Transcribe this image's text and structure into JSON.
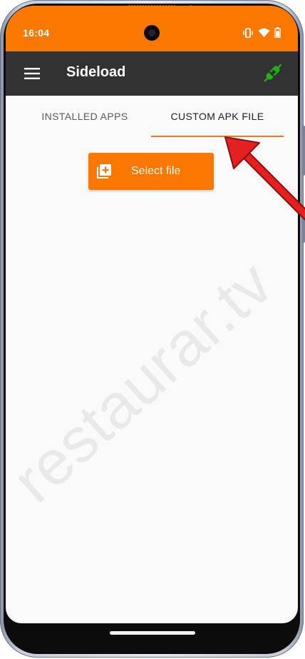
{
  "status_bar": {
    "time": "16:04",
    "icons": [
      "vibrate-icon",
      "wifi-icon",
      "battery-icon"
    ],
    "color": "#fb7800"
  },
  "app_bar": {
    "title": "Sideload",
    "menu_icon": "menu-icon",
    "action_icon": "plug-connect-icon",
    "action_color": "#1db312",
    "color": "#323232"
  },
  "tabs": [
    {
      "label": "INSTALLED APPS",
      "selected": false
    },
    {
      "label": "CUSTOM APK FILE",
      "selected": true
    }
  ],
  "select_button": {
    "label": "Select file",
    "icon": "add-file-icon",
    "color": "#fb7800"
  },
  "watermark": {
    "text": "restaurar.tv"
  },
  "annotation": {
    "arrow_color": "#e52020"
  }
}
